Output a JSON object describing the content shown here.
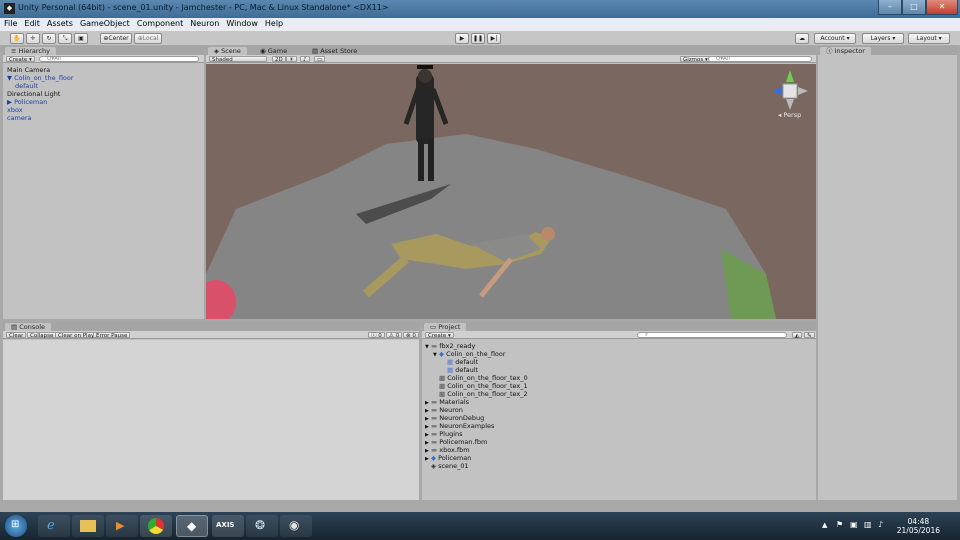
{
  "window": {
    "title": "Unity Personal (64bit) - scene_01.unity - Jamchester - PC, Mac & Linux Standalone* <DX11>",
    "minimize": "–",
    "maximize": "□",
    "close": "✕"
  },
  "menu": [
    "File",
    "Edit",
    "Assets",
    "GameObject",
    "Component",
    "Neuron",
    "Window",
    "Help"
  ],
  "toolbar": {
    "center": "Center",
    "local": "Local",
    "account": "Account",
    "layers": "Layers",
    "layout": "Layout"
  },
  "hierarchy": {
    "tab": "Hierarchy",
    "create": "Create",
    "search_placeholder": "Q▾All",
    "items": [
      {
        "label": "Main Camera",
        "indent": 0,
        "blue": false,
        "arrow": ""
      },
      {
        "label": "Colin_on_the_floor",
        "indent": 0,
        "blue": true,
        "arrow": "▼"
      },
      {
        "label": "default",
        "indent": 2,
        "blue": true,
        "arrow": ""
      },
      {
        "label": "Directional Light",
        "indent": 0,
        "blue": false,
        "arrow": ""
      },
      {
        "label": "Policeman",
        "indent": 0,
        "blue": true,
        "arrow": "▶"
      },
      {
        "label": "xbox",
        "indent": 0,
        "blue": true,
        "arrow": ""
      },
      {
        "label": "camera",
        "indent": 0,
        "blue": true,
        "arrow": ""
      }
    ]
  },
  "scene": {
    "tabs": [
      "Scene",
      "Game",
      "Asset Store"
    ],
    "shading": "Shaded",
    "mode2d": "2D",
    "gizmos": "Gizmos",
    "search_placeholder": "Q▾All",
    "persp": "◂ Persp"
  },
  "inspector": {
    "tab": "Inspector"
  },
  "console": {
    "tab": "Console",
    "buttons": [
      "Clear",
      "Collapse",
      "Clear on Play",
      "Error Pause"
    ],
    "counts": [
      "0",
      "0",
      "0"
    ]
  },
  "project": {
    "tab": "Project",
    "create": "Create",
    "items": [
      {
        "label": "fbx2_ready",
        "indent": 0,
        "arrow": "▼",
        "icon": "folder"
      },
      {
        "label": "Colin_on_the_floor",
        "indent": 1,
        "arrow": "▼",
        "icon": "model"
      },
      {
        "label": "default",
        "indent": 2,
        "arrow": "",
        "icon": "mesh"
      },
      {
        "label": "default",
        "indent": 2,
        "arrow": "",
        "icon": "mesh"
      },
      {
        "label": "Colin_on_the_floor_tex_0",
        "indent": 1,
        "arrow": "",
        "icon": "texture"
      },
      {
        "label": "Colin_on_the_floor_tex_1",
        "indent": 1,
        "arrow": "",
        "icon": "texture"
      },
      {
        "label": "Colin_on_the_floor_tex_2",
        "indent": 1,
        "arrow": "",
        "icon": "texture"
      },
      {
        "label": "Materials",
        "indent": 0,
        "arrow": "▶",
        "icon": "folder"
      },
      {
        "label": "Neuron",
        "indent": 0,
        "arrow": "▶",
        "icon": "folder"
      },
      {
        "label": "NeuronDebug",
        "indent": 0,
        "arrow": "▶",
        "icon": "folder"
      },
      {
        "label": "NeuronExamples",
        "indent": 0,
        "arrow": "▶",
        "icon": "folder"
      },
      {
        "label": "Plugins",
        "indent": 0,
        "arrow": "▶",
        "icon": "folder"
      },
      {
        "label": "Policeman.fbm",
        "indent": 0,
        "arrow": "▶",
        "icon": "folder"
      },
      {
        "label": "xbox.fbm",
        "indent": 0,
        "arrow": "▶",
        "icon": "folder"
      },
      {
        "label": "Policeman",
        "indent": 0,
        "arrow": "▶",
        "icon": "model"
      },
      {
        "label": "scene_01",
        "indent": 0,
        "arrow": "",
        "icon": "unity"
      }
    ]
  },
  "taskbar": {
    "apps": [
      "AXIS"
    ],
    "time": "04:48",
    "date": "21/05/2016"
  }
}
